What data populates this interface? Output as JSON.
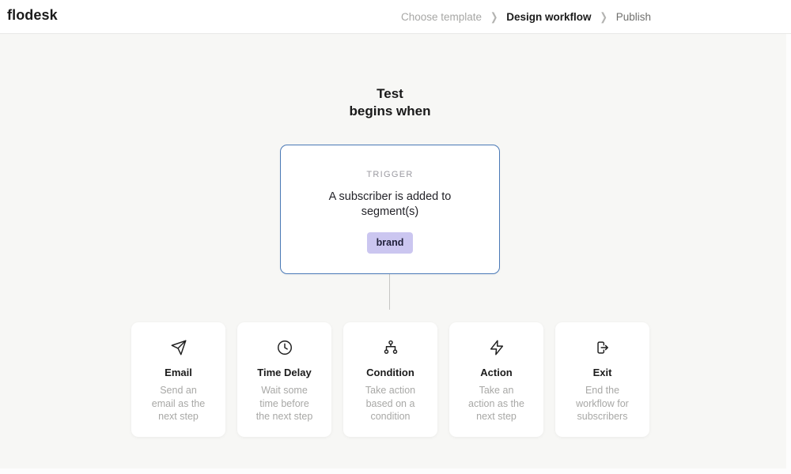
{
  "header": {
    "logo": "flodesk",
    "breadcrumb": {
      "separator": "❯",
      "items": [
        {
          "label": "Choose template",
          "state": "done"
        },
        {
          "label": "Design workflow",
          "state": "active"
        },
        {
          "label": "Publish",
          "state": "upcoming"
        }
      ]
    }
  },
  "canvas": {
    "heading": {
      "line1": "Test",
      "line2": "begins when"
    },
    "trigger": {
      "label": "TRIGGER",
      "description_line1": "A subscriber is added to",
      "description_line2": "segment(s)",
      "tag": "brand"
    },
    "steps": [
      {
        "icon": "send-icon",
        "title": "Email",
        "lines": [
          "Send an",
          "email as the",
          "next step"
        ]
      },
      {
        "icon": "clock-icon",
        "title": "Time Delay",
        "lines": [
          "Wait some",
          "time before",
          "the next step"
        ]
      },
      {
        "icon": "condition-branch-icon",
        "title": "Condition",
        "lines": [
          "Take action",
          "based on a",
          "condition"
        ]
      },
      {
        "icon": "lightning-bolt-icon",
        "title": "Action",
        "lines": [
          "Take an",
          "action as the",
          "next step"
        ]
      },
      {
        "icon": "exit-icon",
        "title": "Exit",
        "lines": [
          "End the",
          "workflow for",
          "subscribers"
        ]
      }
    ]
  },
  "colors": {
    "trigger_border": "#4a79b6",
    "tag_background": "#cbc6f0",
    "tag_text": "#20203a",
    "canvas_background": "#f7f7f5",
    "header_background": "#ffffff",
    "muted_text": "#a8a8a6",
    "primary_text": "#1b1b1b"
  }
}
